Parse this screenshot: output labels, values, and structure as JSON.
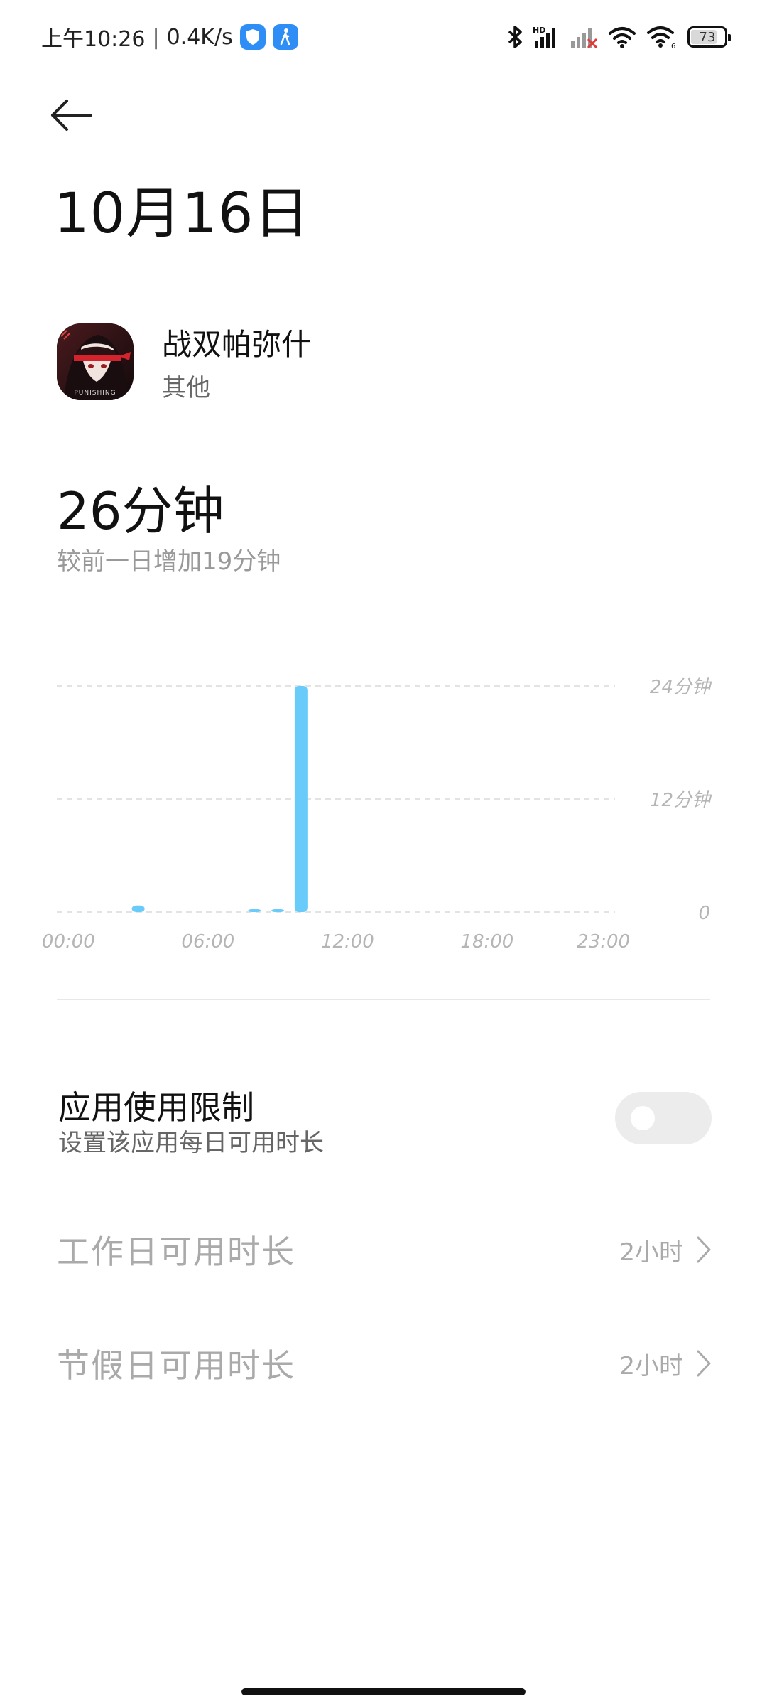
{
  "status_bar": {
    "time": "上午10:26",
    "separator": "|",
    "net_speed": "0.4K/s",
    "battery_level": "73"
  },
  "header": {
    "title": "10月16日"
  },
  "app": {
    "name": "战双帕弥什",
    "category": "其他",
    "icon": "app-artwork"
  },
  "usage": {
    "total": "26分钟",
    "compare": "较前一日增加19分钟"
  },
  "chart_data": {
    "type": "bar",
    "x": [
      3,
      8,
      9,
      10
    ],
    "values": [
      0.7,
      0.2,
      0.2,
      24
    ],
    "ylim": [
      0,
      24
    ],
    "y_ticks": [
      {
        "value": 24,
        "label": "24分钟"
      },
      {
        "value": 12,
        "label": "12分钟"
      },
      {
        "value": 0,
        "label": "0"
      }
    ],
    "x_ticks": [
      {
        "hour": 0,
        "label": "00:00"
      },
      {
        "hour": 6,
        "label": "06:00"
      },
      {
        "hour": 12,
        "label": "12:00"
      },
      {
        "hour": 18,
        "label": "18:00"
      },
      {
        "hour": 23,
        "label": "23:00"
      }
    ],
    "bar_color": "#68cbf9",
    "grid": true,
    "grid_color": "#e3e3e3",
    "tick_color": "#b5b5b5"
  },
  "limit": {
    "title": "应用使用限制",
    "subtitle": "设置该应用每日可用时长",
    "enabled": false
  },
  "settings": [
    {
      "label": "工作日可用时长",
      "value": "2小时"
    },
    {
      "label": "节假日可用时长",
      "value": "2小时"
    }
  ]
}
